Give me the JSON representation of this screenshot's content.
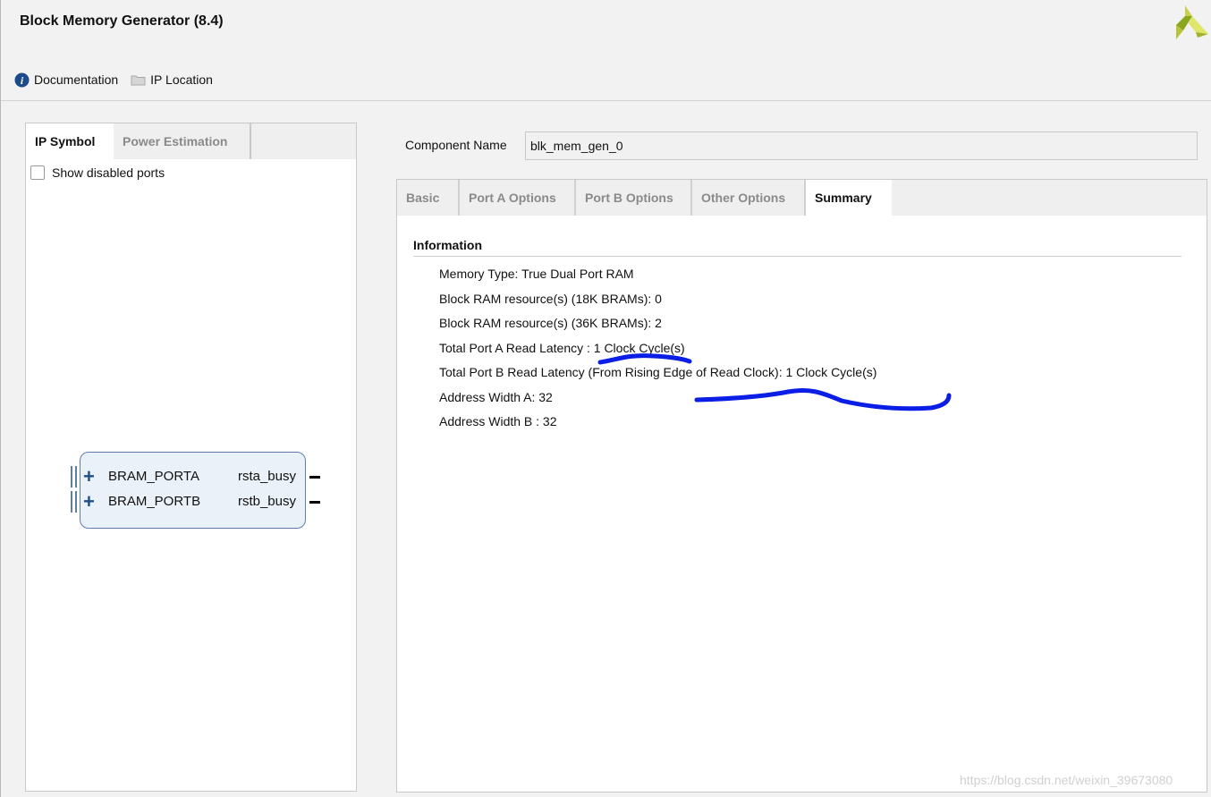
{
  "header": {
    "title": "Block Memory Generator (8.4)",
    "toolbar": [
      {
        "label": "Documentation",
        "icon": "info-icon"
      },
      {
        "label": "IP Location",
        "icon": "folder-icon"
      }
    ]
  },
  "left_panel": {
    "tabs": [
      {
        "label": "IP Symbol",
        "active": true
      },
      {
        "label": "Power Estimation",
        "active": false
      }
    ],
    "show_disabled_ports": {
      "label": "Show disabled ports",
      "checked": false
    },
    "symbol": {
      "ports": [
        {
          "name": "BRAM_PORTA",
          "signal": "rsta_busy"
        },
        {
          "name": "BRAM_PORTB",
          "signal": "rstb_busy"
        }
      ]
    }
  },
  "component": {
    "label": "Component Name",
    "value": "blk_mem_gen_0"
  },
  "right_panel": {
    "tabs": [
      {
        "label": "Basic",
        "active": false
      },
      {
        "label": "Port A Options",
        "active": false
      },
      {
        "label": "Port B Options",
        "active": false
      },
      {
        "label": "Other Options",
        "active": false
      },
      {
        "label": "Summary",
        "active": true
      }
    ],
    "section_title": "Information",
    "items": [
      "Memory Type: True Dual Port RAM",
      "Block RAM resource(s) (18K BRAMs): 0",
      "Block RAM resource(s) (36K BRAMs): 2",
      "Total Port A Read Latency : 1 Clock Cycle(s)",
      "Total Port B Read Latency (From Rising Edge of Read Clock): 1 Clock Cycle(s)",
      "Address Width A: 32",
      "Address Width B : 32"
    ]
  },
  "watermark": "https://blog.csdn.net/weixin_39673080",
  "colors": {
    "accent": "#1f4f86",
    "symbol_fill": "#eaf1f8",
    "annotation": "#0a1ee6",
    "logo": "#8aa61e"
  }
}
